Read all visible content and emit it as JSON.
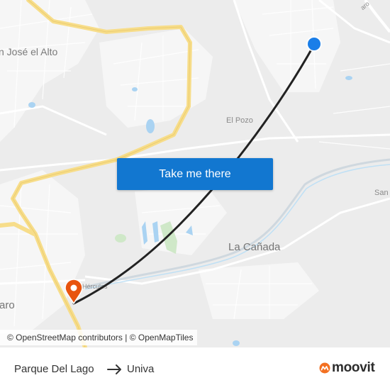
{
  "map": {
    "places": [
      {
        "id": "san-jose-el-alto",
        "label": "n José el Alto"
      },
      {
        "id": "el-pozo",
        "label": "El Pozo"
      },
      {
        "id": "la-canada",
        "label": "La Cañada"
      },
      {
        "id": "san-right",
        "label": "San"
      },
      {
        "id": "hercules",
        "label": "Hércules"
      },
      {
        "id": "queretaro-left",
        "label": "aro"
      },
      {
        "id": "queretaro-top",
        "label": "aro"
      }
    ],
    "route_color": "#222222",
    "origin_marker_color": "#1a7ee8",
    "destination_marker_color": "#e8540f"
  },
  "cta": {
    "label": "Take me there"
  },
  "attribution": {
    "text": "© OpenStreetMap contributors | © OpenMapTiles"
  },
  "route": {
    "from": "Parque Del Lago",
    "to": "Univa"
  },
  "brand": {
    "name": "moovit",
    "accent": "#f37021"
  }
}
